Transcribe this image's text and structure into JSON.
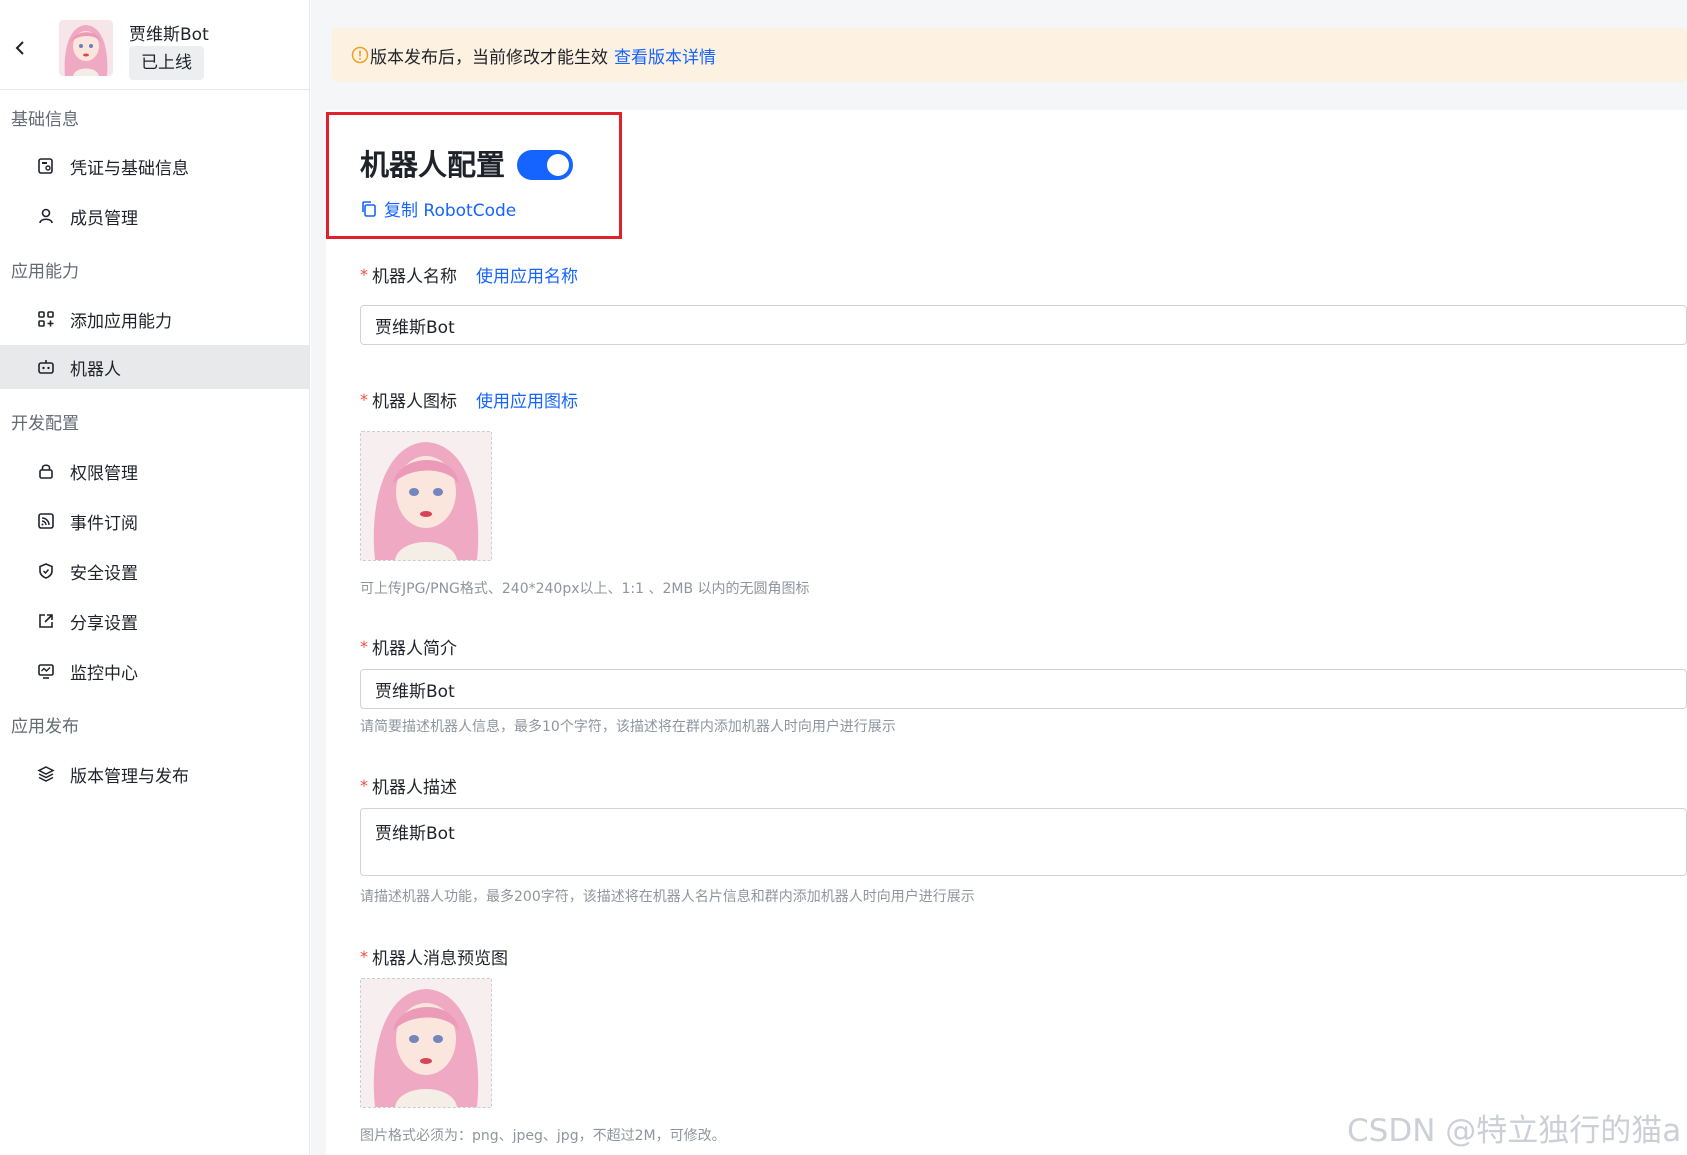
{
  "sidebar": {
    "app_name": "贾维斯Bot",
    "status": "已上线",
    "groups": [
      {
        "title": "基础信息"
      },
      {
        "title": "应用能力"
      },
      {
        "title": "开发配置"
      },
      {
        "title": "应用发布"
      }
    ],
    "items": [
      {
        "label": "凭证与基础信息",
        "icon": "credential-icon"
      },
      {
        "label": "成员管理",
        "icon": "user-icon"
      },
      {
        "label": "添加应用能力",
        "icon": "apps-add-icon"
      },
      {
        "label": "机器人",
        "icon": "robot-icon",
        "active": true
      },
      {
        "label": "权限管理",
        "icon": "lock-icon"
      },
      {
        "label": "事件订阅",
        "icon": "rss-icon"
      },
      {
        "label": "安全设置",
        "icon": "shield-icon"
      },
      {
        "label": "分享设置",
        "icon": "share-icon"
      },
      {
        "label": "监控中心",
        "icon": "monitor-icon"
      },
      {
        "label": "版本管理与发布",
        "icon": "layers-icon"
      }
    ]
  },
  "notice": {
    "text": "版本发布后，当前修改才能生效",
    "link": "查看版本详情"
  },
  "config": {
    "title": "机器人配置",
    "enabled": true,
    "copy_label": "复制 RobotCode"
  },
  "form": {
    "name": {
      "label": "机器人名称",
      "link": "使用应用名称",
      "value": "贾维斯Bot"
    },
    "icon": {
      "label": "机器人图标",
      "link": "使用应用图标",
      "help": "可上传JPG/PNG格式、240*240px以上、1:1 、2MB 以内的无圆角图标"
    },
    "intro": {
      "label": "机器人简介",
      "value": "贾维斯Bot",
      "help": "请简要描述机器人信息，最多10个字符，该描述将在群内添加机器人时向用户进行展示"
    },
    "desc": {
      "label": "机器人描述",
      "value": "贾维斯Bot",
      "help": "请描述机器人功能，最多200字符，该描述将在机器人名片信息和群内添加机器人时向用户进行展示"
    },
    "preview": {
      "label": "机器人消息预览图",
      "help": "图片格式必须为：png、jpeg、jpg，不超过2M，可修改。"
    }
  },
  "watermark": "CSDN @特立独行的猫a",
  "colors": {
    "accent": "#1664ff",
    "highlight": "#e0202a",
    "required": "#f54a45",
    "notice_bg": "#fdf1e1"
  }
}
